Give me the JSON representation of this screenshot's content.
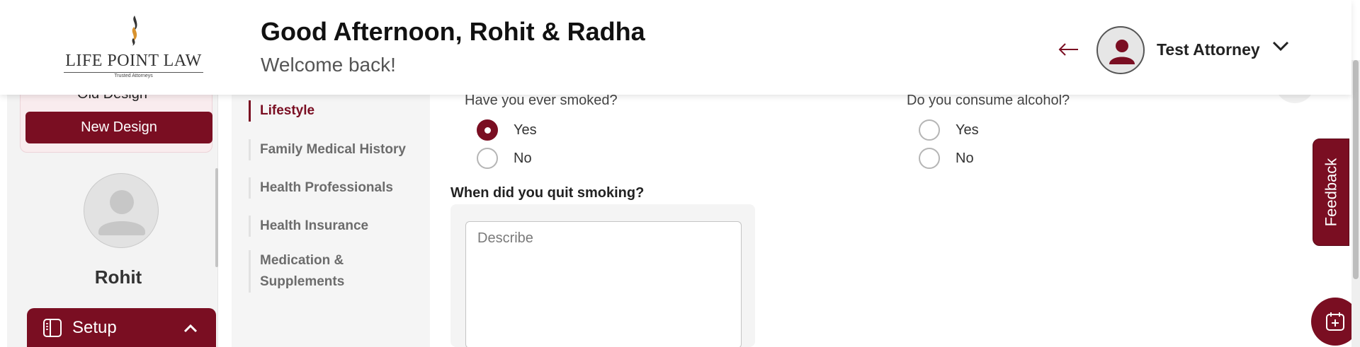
{
  "header": {
    "logo_text": "LIFE POINT LAW",
    "logo_tagline": "Trusted Attorneys",
    "greeting": "Good Afternoon, Rohit & Radha",
    "welcome": "Welcome back!",
    "back_icon": "arrow-left-icon",
    "user_name": "Test Attorney",
    "user_menu_icon": "chevron-down-icon"
  },
  "sidebar": {
    "old_design_label": "Old Design",
    "new_design_label": "New Design",
    "profile_name": "Rohit",
    "setup_label": "Setup",
    "setup_icon": "sidebar-panel-icon",
    "setup_chevron_icon": "chevron-up-icon"
  },
  "steps": {
    "items": [
      {
        "label": "Lifestyle",
        "active": true
      },
      {
        "label": "Family Medical History",
        "active": false
      },
      {
        "label": "Health Professionals",
        "active": false
      },
      {
        "label": "Health Insurance",
        "active": false
      },
      {
        "label": "Medication &",
        "label2": "Supplements",
        "active": false
      }
    ]
  },
  "form": {
    "q_smoked": "Have you ever smoked?",
    "q_alcohol": "Do you consume alcohol?",
    "smoked_options": [
      {
        "label": "Yes",
        "checked": true
      },
      {
        "label": "No",
        "checked": false
      }
    ],
    "alcohol_options": [
      {
        "label": "Yes",
        "checked": false
      },
      {
        "label": "No",
        "checked": false
      }
    ],
    "quit_label": "When did you quit smoking?",
    "quit_placeholder": "Describe"
  },
  "feedback": {
    "label": "Feedback"
  },
  "fab": {
    "icon": "calendar-add-icon"
  },
  "colors": {
    "brand": "#7a0e22",
    "background": "#f3f3f3"
  }
}
